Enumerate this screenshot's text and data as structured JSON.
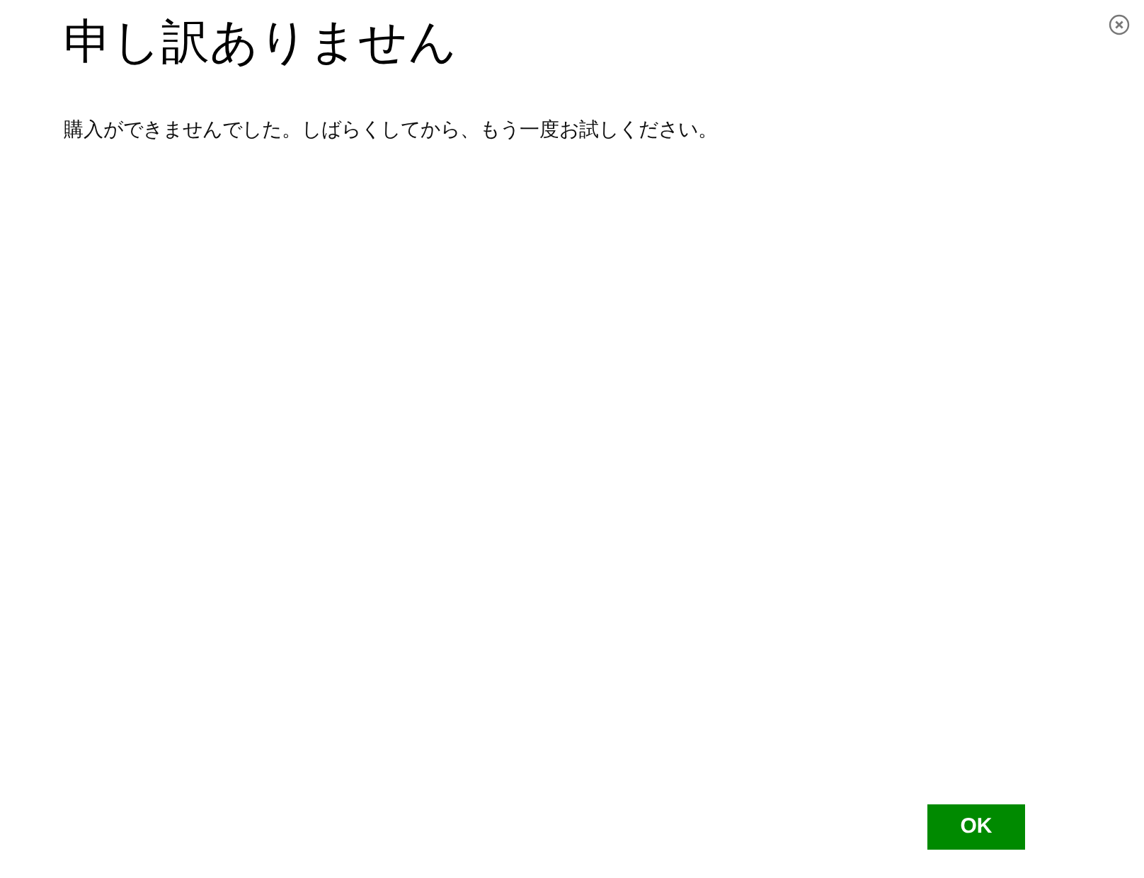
{
  "dialog": {
    "title": "申し訳ありません",
    "message": "購入ができませんでした。しばらくしてから、もう一度お試しください。",
    "buttons": [
      "OK"
    ]
  }
}
